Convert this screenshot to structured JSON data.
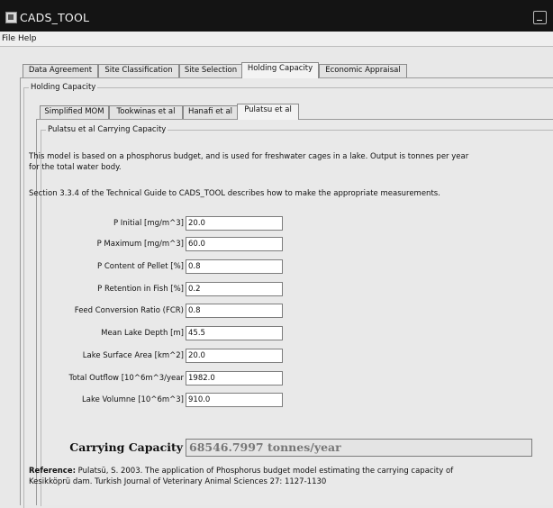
{
  "window": {
    "title": "CADS_TOOL"
  },
  "menu": {
    "file": "File",
    "help": "Help"
  },
  "main_tabs": [
    {
      "label": "Data Agreement"
    },
    {
      "label": "Site Classification"
    },
    {
      "label": "Site Selection"
    },
    {
      "label": "Holding Capacity"
    },
    {
      "label": "Economic Appraisal"
    }
  ],
  "holding_capacity": {
    "group_title": "Holding Capacity",
    "sub_tabs": [
      {
        "label": "Simplified MOM"
      },
      {
        "label": "Tookwinas et al"
      },
      {
        "label": "Hanafi et al"
      },
      {
        "label": "Pulatsu et al"
      }
    ]
  },
  "pulatsu": {
    "group_title": "Pulatsu et al Carrying Capacity",
    "description_line1": "This model is based on a phosphorus budget, and is used for freshwater cages in a lake. Output is tonnes per year",
    "description_line2": "for the total water body.",
    "guide_note": "Section 3.3.4 of the Technical Guide to CADS_TOOL describes how to make the appropriate measurements.",
    "fields": [
      {
        "label": "P Initial [mg/m^3]",
        "value": "20.0"
      },
      {
        "label": "P Maximum [mg/m^3]",
        "value": "60.0"
      },
      {
        "label": "P Content of Pellet [%]",
        "value": "0.8"
      },
      {
        "label": "P Retention in Fish [%]",
        "value": "0.2"
      },
      {
        "label": "Feed Conversion Ratio (FCR)",
        "value": "0.8"
      },
      {
        "label": "Mean Lake Depth [m]",
        "value": "45.5"
      },
      {
        "label": "Lake Surface Area [km^2]",
        "value": "20.0"
      },
      {
        "label": "Total Outflow [10^6m^3/year",
        "value": "1982.0"
      },
      {
        "label": "Lake Volumne [10^6m^3]",
        "value": "910.0"
      }
    ],
    "carrying_capacity_label": "Carrying Capacity",
    "carrying_capacity_value": "68546.7997 tonnes/year",
    "reference_label": "Reference:",
    "reference_line1": " Pulatsü, S. 2003. The application of Phosphorus budget model estimating the carrying capacity of",
    "reference_line2": "Kesikköprü dam. Turkish Journal of Veterinary Animal Sciences 27: 1127-1130"
  }
}
